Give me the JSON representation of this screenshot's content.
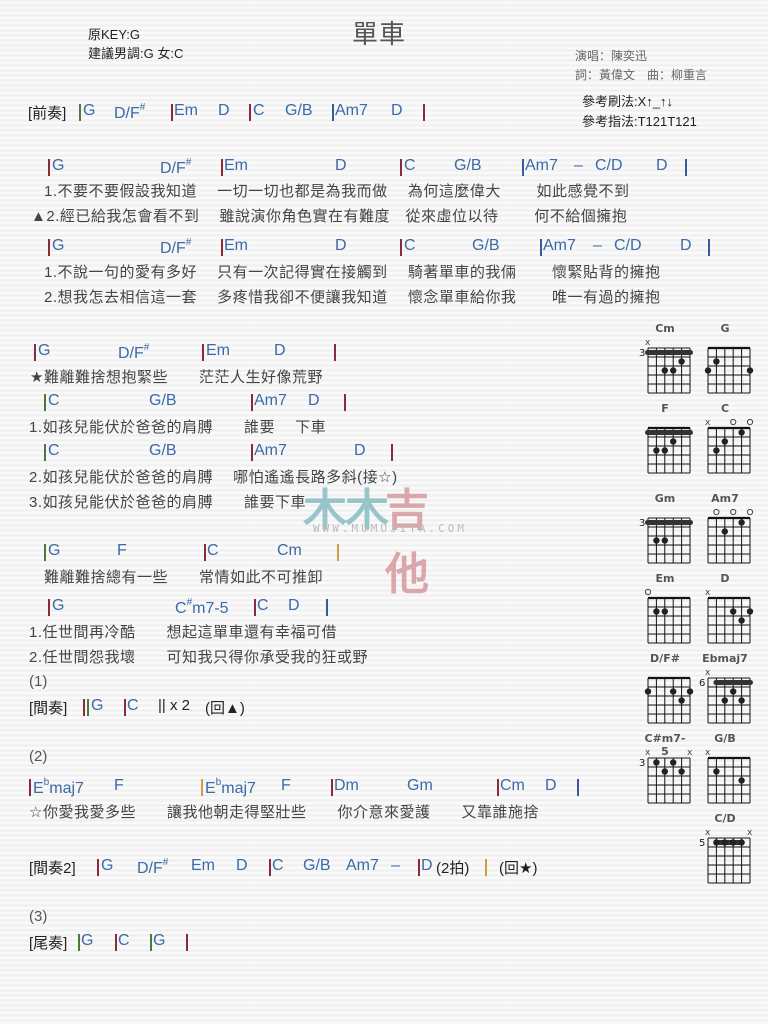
{
  "header": {
    "original_key": "原KEY:G",
    "suggested_key": "建議男調:G 女:C",
    "title": "單車",
    "singer": "演唱：陳奕迅",
    "writers": "詞：黃偉文　曲：柳重言",
    "strum_pattern": "參考刷法:X↑_↑↓",
    "finger_pattern": "參考指法:T121T121"
  },
  "sections": {
    "intro_label": "[前奏]",
    "interlude_label": "[間奏]",
    "interlude2_label": "[間奏2]",
    "outro_label": "[尾奏]",
    "marker1": "(1)",
    "marker2": "(2)",
    "marker3": "(3)",
    "interlude_repeat": "|| x 2",
    "interlude_return": "(回▲)",
    "interlude2_beats": "(2拍)",
    "interlude2_return": "(回★)"
  },
  "chords": {
    "G": "G",
    "DFs": "D/F",
    "Em": "Em",
    "D": "D",
    "C": "C",
    "GB": "G/B",
    "Am7": "Am7",
    "CD": "C/D",
    "F": "F",
    "Cm": "Cm",
    "Csm75": "m7-5",
    "Csm75_root": "C",
    "Ebmaj7_root": "E",
    "Ebmaj7": "maj7",
    "Dm": "Dm",
    "Gm": "Gm",
    "sharp": "#",
    "flat": "b",
    "dash": "–"
  },
  "lyrics": {
    "v1a": "1.不要不要假設我知道　 一切一切也都是為我而做　 為何這麼偉大　　 如此感覺不到",
    "v2a": "▲2.經已給我怎會看不到　 雖說演你角色實在有難度　從來虛位以待　　 何不給個擁抱",
    "v1b": "1.不說一句的愛有多好　 只有一次記得實在接觸到　 騎著單車的我倆　　 懷緊貼背的擁抱",
    "v2b": "2.想我怎去相信這一套　 多疼惜我卻不便讓我知道　 懷念單車給你我　　 唯一有過的擁抱",
    "c1": "★難離難捨想抱緊些　　茫茫人生好像荒野",
    "c2": "1.如孩兒能伏於爸爸的肩膊　　誰要　 下車",
    "c3": "2.如孩兒能伏於爸爸的肩膊　 哪怕遙遙長路多斜(接☆)",
    "c4": "3.如孩兒能伏於爸爸的肩膊　　誰要下車",
    "c5": "難離難捨總有一些　　常情如此不可推卸",
    "c6": "1.任世間再冷酷　　想起這單車還有幸福可借",
    "c7": "2.任世間怨我壞　　可知我只得你承受我的狂或野",
    "bridge": "☆你愛我愛多些　　讓我他朝走得堅壯些　　你介意來愛護　　又靠誰施捨"
  },
  "diagrams": [
    {
      "name": "Cm",
      "fret": "3",
      "mutes": "x",
      "opens": ""
    },
    {
      "name": "G",
      "fret": "",
      "mutes": "",
      "opens": ""
    },
    {
      "name": "F",
      "fret": "",
      "mutes": "",
      "opens": ""
    },
    {
      "name": "C",
      "fret": "",
      "mutes": "x",
      "opens": "o o"
    },
    {
      "name": "Gm",
      "fret": "3",
      "mutes": "",
      "opens": ""
    },
    {
      "name": "Am7",
      "fret": "",
      "mutes": "",
      "opens": "o o o"
    },
    {
      "name": "Em",
      "fret": "",
      "mutes": "",
      "opens": "o"
    },
    {
      "name": "D",
      "fret": "",
      "mutes": "x",
      "opens": ""
    },
    {
      "name": "D/F#",
      "fret": "",
      "mutes": "",
      "opens": ""
    },
    {
      "name": "Ebmaj7",
      "fret": "6",
      "mutes": "x",
      "opens": ""
    },
    {
      "name": "C#m7-5",
      "fret": "3",
      "mutes": "x x",
      "opens": ""
    },
    {
      "name": "G/B",
      "fret": "",
      "mutes": "x",
      "opens": ""
    },
    {
      "name": "C/D",
      "fret": "5",
      "mutes": "x x",
      "opens": ""
    }
  ],
  "watermark": {
    "text_1": "木木",
    "text_2": "吉他",
    "url": "WWW.MUMUJITA.COM"
  }
}
